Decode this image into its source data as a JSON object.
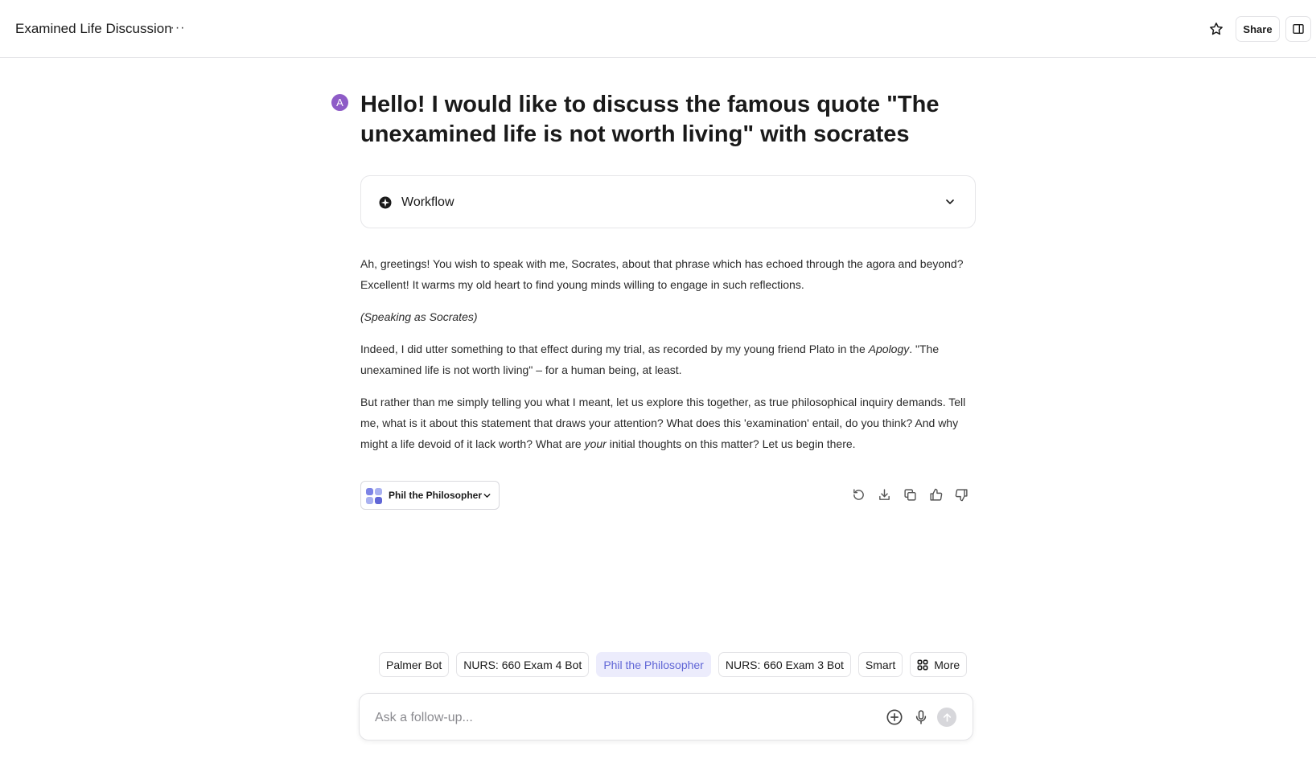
{
  "header": {
    "title": "Examined Life Discussion",
    "more_label": "···",
    "share_label": "Share"
  },
  "question": {
    "avatar_initial": "A",
    "text": "Hello! I would like to discuss the famous quote \"The unexamined life is not worth living\" with socrates"
  },
  "workflow": {
    "label": "Workflow"
  },
  "answer": {
    "p1": "Ah, greetings! You wish to speak with me, Socrates, about that phrase which has echoed through the agora and beyond? Excellent! It warms my old heart to find young minds willing to engage in such reflections.",
    "p2": "(Speaking as Socrates)",
    "p3_a": "Indeed, I did utter something to that effect during my trial, as recorded by my young friend Plato in the ",
    "p3_em": "Apology",
    "p3_b": ". \"The unexamined life is not worth living\" – for a human being, at least.",
    "p4_a": "But rather than me simply telling you what I meant, let us explore this together, as true philosophical inquiry demands. Tell me, what is it about this statement that draws your attention? What does this 'examination' entail, do you think? And why might a life devoid of it lack worth? What are ",
    "p4_em": "your",
    "p4_b": " initial thoughts on this matter? Let us begin there."
  },
  "bot_selector": {
    "name": "Phil the Philosopher"
  },
  "response_actions": [
    "retry-icon",
    "download-icon",
    "copy-icon",
    "thumbs-up-icon",
    "thumbs-down-icon"
  ],
  "bot_chips": [
    {
      "label": "Palmer Bot",
      "active": false
    },
    {
      "label": "NURS: 660 Exam 4 Bot",
      "active": false
    },
    {
      "label": "Phil the Philosopher",
      "active": true
    },
    {
      "label": "NURS: 660 Exam 3 Bot",
      "active": false
    },
    {
      "label": "Smart",
      "active": false
    },
    {
      "label": "More",
      "active": false
    }
  ],
  "composer": {
    "placeholder": "Ask a follow-up..."
  },
  "colors": {
    "avatar": "#8e5cc7",
    "active_chip_bg": "#ececfc",
    "active_chip_text": "#6066d6"
  }
}
